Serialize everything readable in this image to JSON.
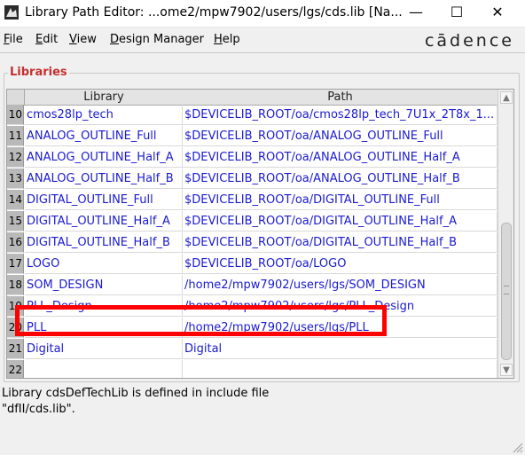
{
  "window": {
    "title": "Library Path Editor: ...ome2/mpw7902/users/lgs/cds.lib [Na...",
    "controls": {
      "minimize": "—",
      "maximize": "☐",
      "close": "✕"
    },
    "app_icon": "library-path-editor-icon"
  },
  "menu": {
    "items": [
      {
        "label": "File",
        "accel": "F",
        "rest": "ile"
      },
      {
        "label": "Edit",
        "accel": "E",
        "rest": "dit"
      },
      {
        "label": "View",
        "accel": "V",
        "rest": "iew"
      },
      {
        "label": "Design Manager",
        "accel": "D",
        "rest": "esign Manager"
      },
      {
        "label": "Help",
        "accel": "H",
        "rest": "elp"
      }
    ],
    "brand": "cādence"
  },
  "libraries": {
    "group_title": "Libraries",
    "columns": [
      "Library",
      "Path"
    ],
    "rows": [
      {
        "num": "10",
        "library": "cmos28lp_tech",
        "path": "$DEVICELIB_ROOT/oa/cmos28lp_tech_7U1x_2T8x_1..."
      },
      {
        "num": "11",
        "library": "ANALOG_OUTLINE_Full",
        "path": "$DEVICELIB_ROOT/oa/ANALOG_OUTLINE_Full"
      },
      {
        "num": "12",
        "library": "ANALOG_OUTLINE_Half_A",
        "path": "$DEVICELIB_ROOT/oa/ANALOG_OUTLINE_Half_A"
      },
      {
        "num": "13",
        "library": "ANALOG_OUTLINE_Half_B",
        "path": "$DEVICELIB_ROOT/oa/ANALOG_OUTLINE_Half_B"
      },
      {
        "num": "14",
        "library": "DIGITAL_OUTLINE_Full",
        "path": "$DEVICELIB_ROOT/oa/DIGITAL_OUTLINE_Full"
      },
      {
        "num": "15",
        "library": "DIGITAL_OUTLINE_Half_A",
        "path": "$DEVICELIB_ROOT/oa/DIGITAL_OUTLINE_Half_A"
      },
      {
        "num": "16",
        "library": "DIGITAL_OUTLINE_Half_B",
        "path": "$DEVICELIB_ROOT/oa/DIGITAL_OUTLINE_Half_B"
      },
      {
        "num": "17",
        "library": "LOGO",
        "path": "$DEVICELIB_ROOT/oa/LOGO"
      },
      {
        "num": "18",
        "library": "SOM_DESIGN",
        "path": "/home2/mpw7902/users/lgs/SOM_DESIGN"
      },
      {
        "num": "19",
        "library": "PLL_Design",
        "path": "/home2/mpw7902/users/lgs/PLL_Design"
      },
      {
        "num": "20",
        "library": "PLL",
        "path": "/home2/mpw7902/users/lgs/PLL"
      },
      {
        "num": "21",
        "library": "Digital",
        "path": "Digital"
      },
      {
        "num": "22",
        "library": "",
        "path": ""
      }
    ]
  },
  "status": {
    "line1": "Library cdsDefTechLib is defined in include file",
    "line2": "\"dfII/cds.lib\"."
  },
  "colors": {
    "group_title": "#c43030",
    "cell_text": "#1a1ad0",
    "highlight": "#ff0000"
  }
}
